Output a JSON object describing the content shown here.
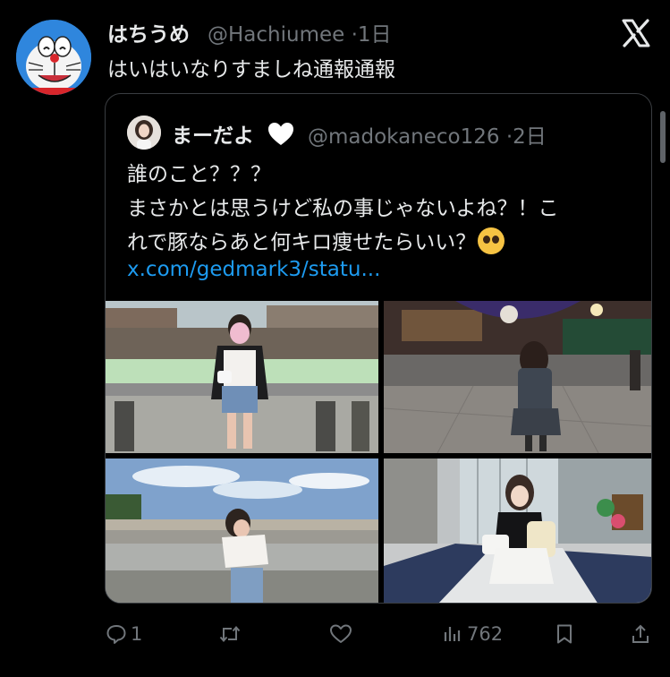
{
  "tweet": {
    "author": {
      "display_name": "はちうめ",
      "handle": "@Hachiumee",
      "time": "1日"
    },
    "text": "はいはいなりすましね通報通報",
    "platform_icon": "x-logo-icon"
  },
  "quoted_tweet": {
    "author": {
      "display_name": "まーだよ",
      "name_emoji": "white-heart-icon",
      "handle": "@madokaneco126",
      "time": "2日"
    },
    "lines": [
      "誰のこと？？？",
      "まさかとは思うけど私の事じゃないよね？！こ",
      "れで豚ならあと何キロ痩せたらいい？"
    ],
    "line3_emoji": "pleading-face-icon",
    "link": "x.com/gedmark3/statu..."
  },
  "actions": {
    "reply_count": "1",
    "retweet_count": "",
    "like_count": "",
    "views_count": "762"
  },
  "colors": {
    "background": "#000000",
    "text": "#e7e9ea",
    "muted": "#71767b",
    "link": "#1d9bf0",
    "border": "#3a3d41"
  }
}
